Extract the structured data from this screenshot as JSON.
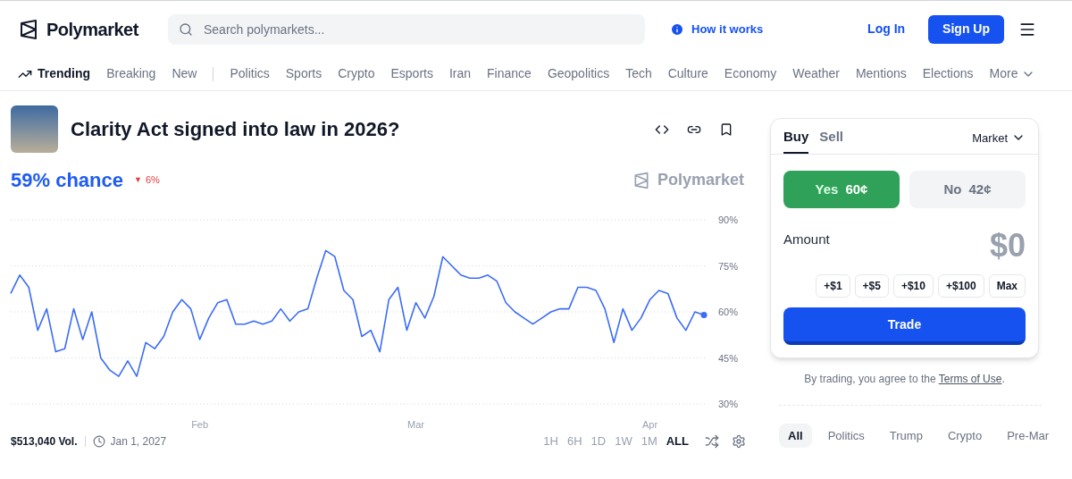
{
  "header": {
    "brand": "Polymarket",
    "search": {
      "placeholder": "Search polymarkets..."
    },
    "how_it_works": "How it works",
    "log_in": "Log In",
    "sign_up": "Sign Up"
  },
  "nav": [
    {
      "label": "Trending",
      "selected": true
    },
    {
      "label": "Breaking",
      "selected": false
    },
    {
      "label": "New",
      "selected": false
    },
    {
      "label": "Politics",
      "selected": false
    },
    {
      "label": "Sports",
      "selected": false
    },
    {
      "label": "Crypto",
      "selected": false
    },
    {
      "label": "Esports",
      "selected": false
    },
    {
      "label": "Iran",
      "selected": false
    },
    {
      "label": "Finance",
      "selected": false
    },
    {
      "label": "Geopolitics",
      "selected": false
    },
    {
      "label": "Tech",
      "selected": false
    },
    {
      "label": "Culture",
      "selected": false
    },
    {
      "label": "Economy",
      "selected": false
    },
    {
      "label": "Weather",
      "selected": false
    },
    {
      "label": "Mentions",
      "selected": false
    },
    {
      "label": "Elections",
      "selected": false
    }
  ],
  "nav_more": "More",
  "market": {
    "title": "Clarity Act signed into law in 2026?",
    "chance": "59% chance",
    "change_marker": "▼",
    "change": "6%",
    "watermark": "Polymarket",
    "volume": "$513,040 Vol.",
    "end_date": "Jan 1, 2027"
  },
  "chart_data": {
    "type": "line",
    "grid": true,
    "ylim": [
      30,
      90
    ],
    "yticks": [
      {
        "value": 90,
        "label": "90%"
      },
      {
        "value": 75,
        "label": "75%"
      },
      {
        "value": 60,
        "label": "60%"
      },
      {
        "value": 45,
        "label": "45%"
      },
      {
        "value": 30,
        "label": "30%"
      }
    ],
    "categories": [
      null,
      null,
      null,
      null,
      null,
      null,
      null,
      null,
      null,
      null,
      null,
      null,
      null,
      null,
      null,
      null,
      null,
      null,
      null,
      null,
      null,
      "Feb",
      null,
      null,
      null,
      null,
      null,
      null,
      null,
      null,
      null,
      null,
      null,
      null,
      null,
      null,
      null,
      null,
      null,
      null,
      null,
      null,
      null,
      null,
      null,
      "Mar",
      null,
      null,
      null,
      null,
      null,
      null,
      null,
      null,
      null,
      null,
      null,
      null,
      null,
      null,
      null,
      null,
      null,
      null,
      null,
      null,
      null,
      null,
      null,
      null,
      null,
      "Apr",
      null,
      null,
      null,
      null,
      null,
      null
    ],
    "series": [
      {
        "color": "#3b6cf6",
        "values": [
          66,
          72,
          68,
          54,
          61,
          47,
          48,
          61,
          51,
          60,
          45,
          41,
          39,
          44,
          39,
          50,
          48,
          52,
          60,
          64,
          61,
          51,
          58,
          63,
          64,
          56,
          56,
          57,
          56,
          57,
          61,
          57,
          60,
          61,
          71,
          80,
          78,
          67,
          64,
          52,
          54,
          47,
          64,
          68,
          54,
          63,
          58,
          65,
          78,
          75,
          72,
          71,
          71,
          72,
          70,
          63,
          60,
          58,
          56,
          58,
          60,
          61,
          61,
          68,
          68,
          67,
          61,
          50,
          61,
          54,
          58,
          64,
          67,
          66,
          58,
          54,
          60,
          59
        ]
      }
    ]
  },
  "timeframes": [
    {
      "label": "1H",
      "selected": false
    },
    {
      "label": "6H",
      "selected": false
    },
    {
      "label": "1D",
      "selected": false
    },
    {
      "label": "1W",
      "selected": false
    },
    {
      "label": "1M",
      "selected": false
    },
    {
      "label": "ALL",
      "selected": true
    }
  ],
  "trade": {
    "tabs": [
      {
        "label": "Buy",
        "selected": true
      },
      {
        "label": "Sell",
        "selected": false
      }
    ],
    "order_type": "Market",
    "outcomes": [
      {
        "label": "Yes",
        "price": "60¢",
        "selected": true
      },
      {
        "label": "No",
        "price": "42¢",
        "selected": false
      }
    ],
    "amount_label": "Amount",
    "amount": "$0",
    "increments": [
      "+$1",
      "+$5",
      "+$10",
      "+$100",
      "Max"
    ],
    "submit": "Trade",
    "terms_prefix": "By trading, you agree to the ",
    "terms_link": "Terms of Use",
    "terms_suffix": "."
  },
  "filters": [
    {
      "label": "All",
      "selected": true
    },
    {
      "label": "Politics",
      "selected": false
    },
    {
      "label": "Trump",
      "selected": false
    },
    {
      "label": "Crypto",
      "selected": false
    },
    {
      "label": "Pre-Mar",
      "selected": false
    }
  ]
}
